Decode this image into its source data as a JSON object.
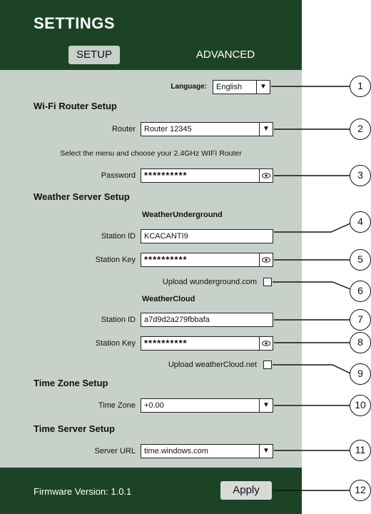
{
  "header": {
    "title": "SETTINGS",
    "tabs": [
      {
        "label": "SETUP"
      },
      {
        "label": "ADVANCED"
      }
    ]
  },
  "language": {
    "label": "Language",
    "value": "English"
  },
  "wifi": {
    "section_title": "Wi-Fi Router Setup",
    "router_label": "Router",
    "router_value": "Router 12345",
    "note": "Select the menu and choose your 2.4GHz WIFI Router",
    "password_label": "Password",
    "password_value": "**********"
  },
  "weather_server": {
    "section_title": "Weather Server Setup",
    "wu": {
      "title": "WeatherUnderground",
      "station_id_label": "Station ID",
      "station_id_value": "KCACANTI9",
      "station_key_label": "Station Key",
      "station_key_value": "**********",
      "upload_label": "Upload wunderground.com"
    },
    "wc": {
      "title": "WeatherCloud",
      "station_id_label": "Station ID",
      "station_id_value": "a7d9d2a279fbbafa",
      "station_key_label": "Station Key",
      "station_key_value": "**********",
      "upload_label": "Upload weatherCloud.net"
    }
  },
  "timezone": {
    "section_title": "Time Zone Setup",
    "label": "Time Zone",
    "value": "+0.00"
  },
  "timeserver": {
    "section_title": "Time Server Setup",
    "label": "Server URL",
    "value": "time.windows.com"
  },
  "footer": {
    "firmware": "Firmware Version: 1.0.1",
    "apply_label": "Apply"
  },
  "callouts": [
    "1",
    "2",
    "3",
    "4",
    "5",
    "6",
    "7",
    "8",
    "9",
    "10",
    "11",
    "12"
  ],
  "icons": {
    "dropdown": "triangle-down-icon",
    "reveal": "eye-icon"
  },
  "colors": {
    "header_bg": "#1d4326",
    "panel_bg": "#c8d0ca",
    "field_bg": "#ffffff"
  }
}
